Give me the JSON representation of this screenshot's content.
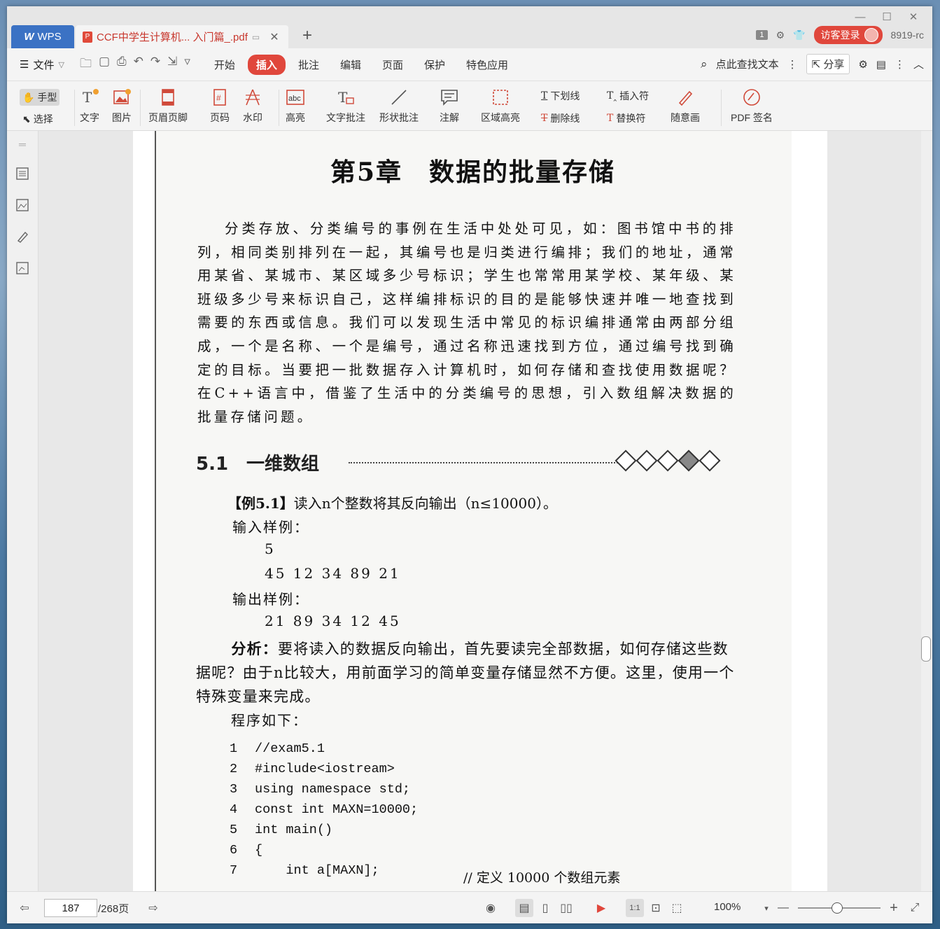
{
  "window": {
    "minimize": "—",
    "maximize": "☐",
    "close": "✕"
  },
  "tabs": {
    "wps_label": "WPS",
    "doc_title": "CCF中学生计算机... 入门篇_.pdf",
    "page_badge": "1",
    "login": "访客登录",
    "user": "8919-rc"
  },
  "menu": {
    "file": "文件",
    "items": [
      "开始",
      "插入",
      "批注",
      "编辑",
      "页面",
      "保护",
      "特色应用"
    ],
    "active_index": 1,
    "search": "点此查找文本",
    "share": "分享"
  },
  "ribbon": {
    "hand": "手型",
    "select": "选择",
    "text": "文字",
    "image": "图片",
    "header_footer": "页眉页脚",
    "page_num": "页码",
    "watermark": "水印",
    "highlight": "高亮",
    "text_note": "文字批注",
    "shape_note": "形状批注",
    "annotation": "注解",
    "area_highlight": "区域高亮",
    "underline": "下划线",
    "strikethrough": "删除线",
    "insert_mark": "插入符",
    "replace_mark": "替换符",
    "freehand": "随意画",
    "pdf_sign": "PDF 签名"
  },
  "document": {
    "chapter_title": "第5章　数据的批量存储",
    "intro": "分类存放、分类编号的事例在生活中处处可见，如：图书馆中书的排列，相同类别排列在一起，其编号也是归类进行编排；我们的地址，通常用某省、某城市、某区域多少号标识；学生也常常用某学校、某年级、某班级多少号来标识自己，这样编排标识的目的是能够快速并唯一地查找到需要的东西或信息。我们可以发现生活中常见的标识编排通常由两部分组成，一个是名称、一个是编号，通过名称迅速找到方位，通过编号找到确定的目标。当要把一批数据存入计算机时，如何存储和查找使用数据呢？在C++语言中，借鉴了生活中的分类编号的思想，引入数组解决数据的批量存储问题。",
    "section": "5.1　一维数组",
    "example_tag": "【例5.1】",
    "example_text": "读入n个整数将其反向输出（n≤10000）。",
    "input_label": "输入样例：",
    "input_1": "5",
    "input_2": "45 12 34 89 21",
    "output_label": "输出样例：",
    "output_1": "21 89 34 12 45",
    "analysis_tag": "分析：",
    "analysis_text": "要将读入的数据反向输出，首先要读完全部数据，如何存储这些数据呢？由于n比较大，用前面学习的简单变量存储显然不方便。这里，使用一个特殊变量来完成。",
    "program_label": "程序如下：",
    "code": [
      {
        "n": "1",
        "t": "//exam5.1"
      },
      {
        "n": "2",
        "t": "#include<iostream>"
      },
      {
        "n": "3",
        "t": "using namespace std;"
      },
      {
        "n": "4",
        "t": "const int MAXN=10000;"
      },
      {
        "n": "5",
        "t": "int main()"
      },
      {
        "n": "6",
        "t": "{"
      },
      {
        "n": "7",
        "t": "    int a[MAXN];"
      }
    ],
    "code_comment": "// 定义 10000 个数组元素"
  },
  "status": {
    "page_current": "187",
    "page_total": "/268页",
    "zoom": "100%"
  }
}
